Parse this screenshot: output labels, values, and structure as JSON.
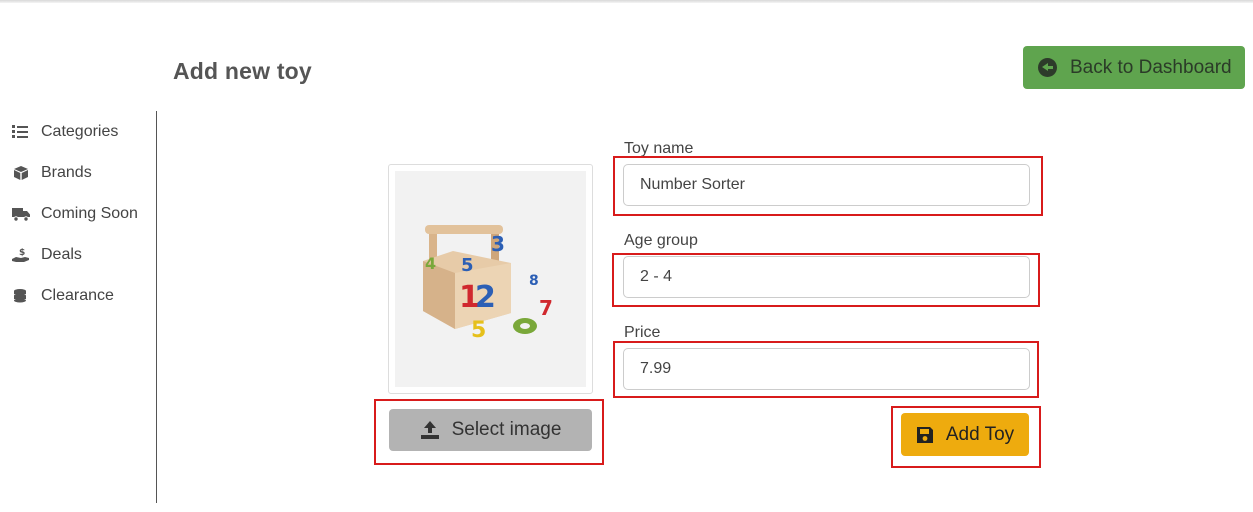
{
  "page": {
    "title": "Add new toy"
  },
  "header": {
    "back_label": "Back to Dashboard"
  },
  "sidebar": {
    "items": [
      {
        "label": "Categories",
        "icon": "list-icon"
      },
      {
        "label": "Brands",
        "icon": "box-icon"
      },
      {
        "label": "Coming Soon",
        "icon": "truck-icon"
      },
      {
        "label": "Deals",
        "icon": "hand-dollar-icon"
      },
      {
        "label": "Clearance",
        "icon": "coins-icon"
      }
    ]
  },
  "form": {
    "toy_name": {
      "label": "Toy name",
      "value": "Number Sorter"
    },
    "age_group": {
      "label": "Age group",
      "value": "2 - 4"
    },
    "price": {
      "label": "Price",
      "value": "7.99"
    },
    "select_image_label": "Select image",
    "add_toy_label": "Add Toy"
  },
  "colors": {
    "back_button": "#5fa44e",
    "add_button": "#eeab0e",
    "select_button": "#b3b3b3",
    "highlight": "#d81b1b"
  }
}
